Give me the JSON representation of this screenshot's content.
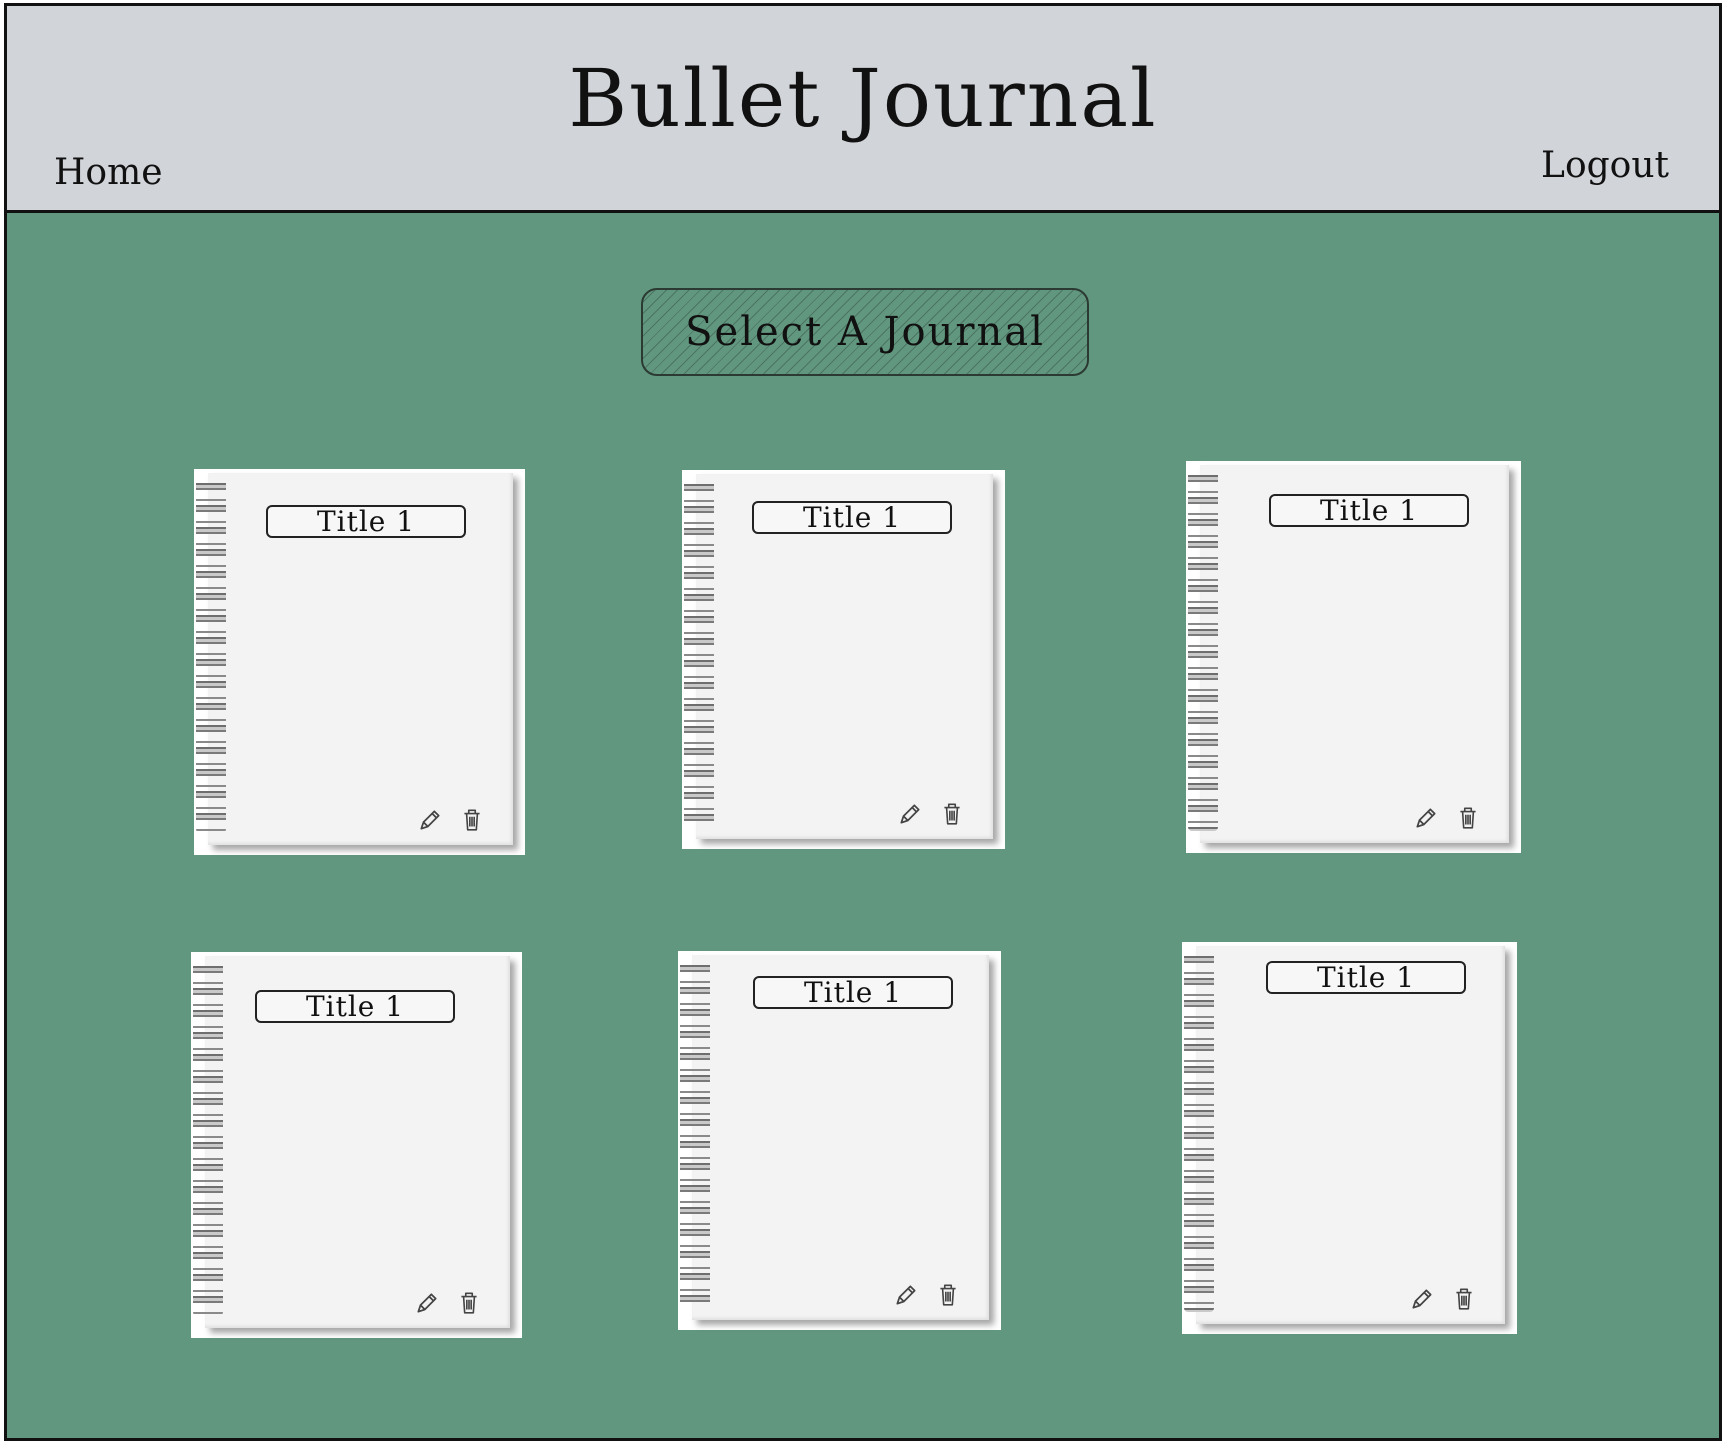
{
  "header": {
    "title": "Bullet Journal",
    "home_label": "Home",
    "logout_label": "Logout"
  },
  "main": {
    "select_label": "Select A Journal",
    "journals": [
      {
        "title": "Title 1",
        "icons": [
          "pencil-icon",
          "trash-icon"
        ]
      },
      {
        "title": "Title 1",
        "icons": [
          "pencil-icon",
          "trash-icon"
        ]
      },
      {
        "title": "Title 1",
        "icons": [
          "pencil-icon",
          "trash-icon"
        ]
      },
      {
        "title": "Title 1",
        "icons": [
          "pencil-icon",
          "trash-icon"
        ]
      },
      {
        "title": "Title 1",
        "icons": [
          "pencil-icon",
          "trash-icon"
        ]
      },
      {
        "title": "Title 1",
        "icons": [
          "pencil-icon",
          "trash-icon"
        ]
      }
    ]
  },
  "colors": {
    "header_bg": "#d1d4d9",
    "body_bg": "#62977f",
    "page_bg": "#f3f3f3"
  }
}
